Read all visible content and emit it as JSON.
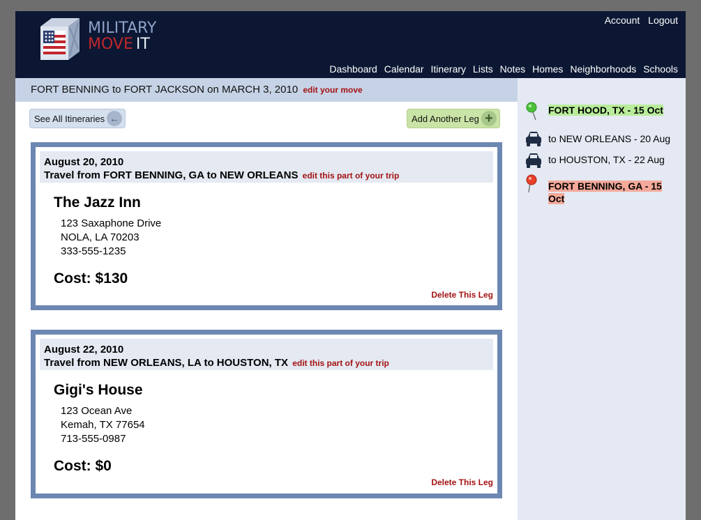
{
  "logo": {
    "line1": "MILITARY",
    "line2_a": "MOVE",
    "line2_b": "IT"
  },
  "top_links": {
    "account": "Account",
    "logout": "Logout"
  },
  "nav": [
    "Dashboard",
    "Calendar",
    "Itinerary",
    "Lists",
    "Notes",
    "Homes",
    "Neighborhoods",
    "Schools"
  ],
  "move": {
    "title": "FORT BENNING to FORT JACKSON on MARCH 3, 2010",
    "edit": "edit your move"
  },
  "buttons": {
    "see_all": "See All Itineraries",
    "add_leg": "Add Another Leg"
  },
  "legs": [
    {
      "date": "August 20, 2010",
      "route": "Travel from FORT BENNING, GA to NEW ORLEANS",
      "edit": "edit this part of your trip",
      "place": "The Jazz Inn",
      "address1": "123 Saxaphone Drive",
      "address2": "NOLA, LA 70203",
      "phone": "333-555-1235",
      "cost": "Cost: $130",
      "delete": "Delete This Leg"
    },
    {
      "date": "August 22, 2010",
      "route": "Travel from NEW ORLEANS, LA to HOUSTON, TX",
      "edit": "edit this part of your trip",
      "place": "Gigi's House",
      "address1": "123 Ocean Ave",
      "address2": "Kemah, TX 77654",
      "phone": "713-555-0987",
      "cost": "Cost: $0",
      "delete": "Delete This Leg"
    }
  ],
  "sidebar": {
    "start": "FORT HOOD, TX - 15 Oct",
    "stops": [
      "to NEW ORLEANS - 20 Aug",
      "to HOUSTON, TX - 22 Aug"
    ],
    "end": "FORT BENNING, GA - 15 Oct"
  },
  "colors": {
    "header": "#0b1733",
    "accent_red": "#a31212",
    "start_highlight": "#b8ec9a",
    "end_highlight": "#f4a99a"
  }
}
